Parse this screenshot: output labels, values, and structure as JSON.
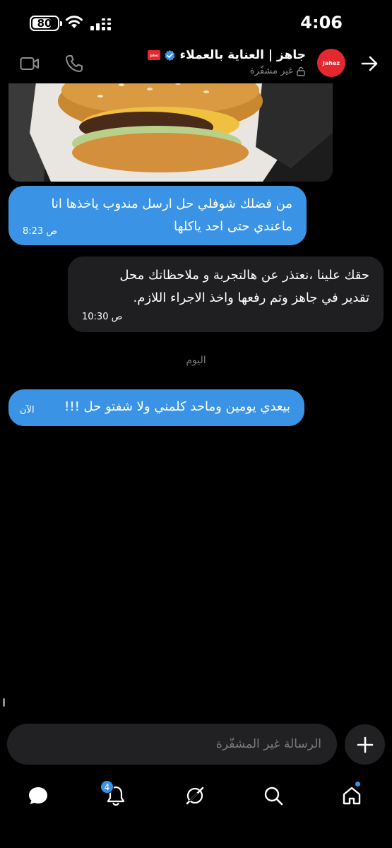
{
  "status_bar": {
    "time": "4:06",
    "battery_percent": 80,
    "battery_label": "80"
  },
  "header": {
    "title": "جاهز | العناية بالعملاء",
    "subtitle": "غير مشفّرة",
    "avatar_logo_text": "Jahez",
    "brand_badge_text": "Jahez"
  },
  "messages": [
    {
      "type": "image",
      "direction": "incoming",
      "description_icon": "burger-photo"
    },
    {
      "type": "text",
      "direction": "incoming",
      "lines": [
        "من فضلك شوفلي حل ارسل مندوب ياخذها انا",
        "ماعندي حتى احد ياكلها"
      ],
      "time": "8:23 ص"
    },
    {
      "type": "text",
      "direction": "outgoing",
      "lines": [
        "حقك علينا ،نعتذر عن هالتجربة و ملاحظاتك محل",
        "تقدير في جاهز وتم رفعها واخذ الاجراء اللازم."
      ],
      "time": "10:30 ص"
    },
    {
      "type": "text",
      "direction": "incoming",
      "lines": [
        "بيعدي يومين وماحد كلمني ولا شفتو حل !!!"
      ],
      "time": "الآن"
    }
  ],
  "day_separator": "اليوم",
  "composer": {
    "placeholder": "الرسالة غير المشفّرة"
  },
  "bottom_nav": {
    "notifications_badge": "4",
    "items": [
      "messages-icon",
      "notifications-icon",
      "grok-icon",
      "search-icon",
      "home-icon"
    ]
  },
  "colors": {
    "incoming_bubble": "#3b93e6",
    "outgoing_bubble": "#1f1f21",
    "brand": "#e3282f",
    "background": "#000000"
  }
}
